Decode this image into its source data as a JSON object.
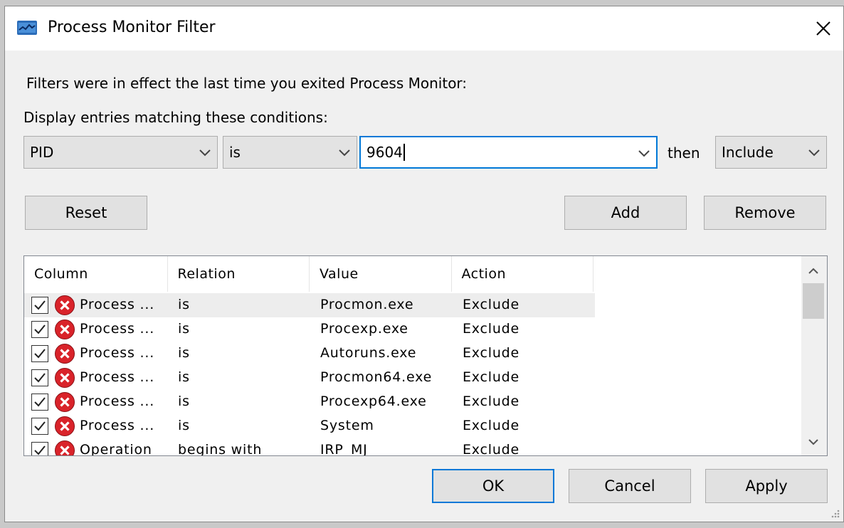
{
  "window": {
    "title": "Process Monitor Filter"
  },
  "info_text": "Filters were in effect the last time you exited Process Monitor:",
  "conditions_label": "Display entries matching these conditions:",
  "condition": {
    "column": "PID",
    "relation": "is",
    "value": "9604",
    "then_label": "then",
    "action": "Include"
  },
  "buttons": {
    "reset": "Reset",
    "add": "Add",
    "remove": "Remove",
    "ok": "OK",
    "cancel": "Cancel",
    "apply": "Apply"
  },
  "table": {
    "headers": [
      "Column",
      "Relation",
      "Value",
      "Action"
    ],
    "rows": [
      {
        "column": "Process ...",
        "relation": "is",
        "value": "Procmon.exe",
        "action": "Exclude",
        "checked": true
      },
      {
        "column": "Process ...",
        "relation": "is",
        "value": "Procexp.exe",
        "action": "Exclude",
        "checked": true
      },
      {
        "column": "Process ...",
        "relation": "is",
        "value": "Autoruns.exe",
        "action": "Exclude",
        "checked": true
      },
      {
        "column": "Process ...",
        "relation": "is",
        "value": "Procmon64.exe",
        "action": "Exclude",
        "checked": true
      },
      {
        "column": "Process ...",
        "relation": "is",
        "value": "Procexp64.exe",
        "action": "Exclude",
        "checked": true
      },
      {
        "column": "Process ...",
        "relation": "is",
        "value": "System",
        "action": "Exclude",
        "checked": true
      },
      {
        "column": "Operation",
        "relation": "begins with",
        "value": "IRP_MJ_",
        "action": "Exclude",
        "checked": true
      }
    ]
  },
  "colors": {
    "accent": "#0078d7",
    "exclude_icon": "#d9232a"
  },
  "icons": {
    "app": "process-monitor-icon",
    "close": "close-icon",
    "dropdown": "chevron-down-icon",
    "exclude": "exclude-x-icon",
    "check": "checkmark-icon"
  }
}
